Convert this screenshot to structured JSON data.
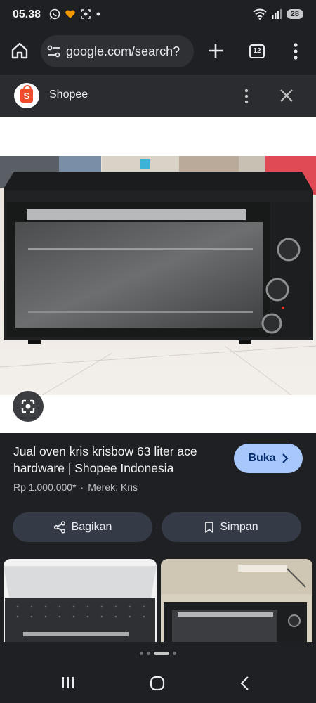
{
  "status": {
    "time": "05.38",
    "battery": "28"
  },
  "browser": {
    "url": "google.com/search?",
    "tab_count": "12"
  },
  "sheet": {
    "site_name": "Shopee",
    "logo_letter": "S"
  },
  "result": {
    "title": "Jual oven kris krisbow 63 liter ace hardware | Shopee Indonesia",
    "open_label": "Buka",
    "price": "Rp 1.000.000*",
    "brand": "Merek: Kris",
    "separator": "·"
  },
  "actions": {
    "share_label": "Bagikan",
    "save_label": "Simpan"
  },
  "icons": {
    "status_left": [
      "whatsapp-icon",
      "heart-app-icon",
      "screenshot-icon",
      "dot-icon"
    ],
    "status_right": [
      "wifi-icon",
      "signal-icon",
      "battery-icon"
    ],
    "browser": [
      "home-icon",
      "tune-icon",
      "plus-icon",
      "tabs-icon",
      "more-vert-icon"
    ],
    "sheet": [
      "shopee-logo",
      "more-vert-icon",
      "close-icon"
    ],
    "nav": [
      "recent-apps-icon",
      "home-nav-icon",
      "back-icon"
    ]
  },
  "colors": {
    "background": "#1f2023",
    "sheet_header": "#2b2c2f",
    "primary_button": "#a8c7fa",
    "tonal_button": "#343a46",
    "shopee_brand": "#ee4d2d"
  },
  "carousel": {
    "dot_count": 5,
    "active_index": 2
  }
}
